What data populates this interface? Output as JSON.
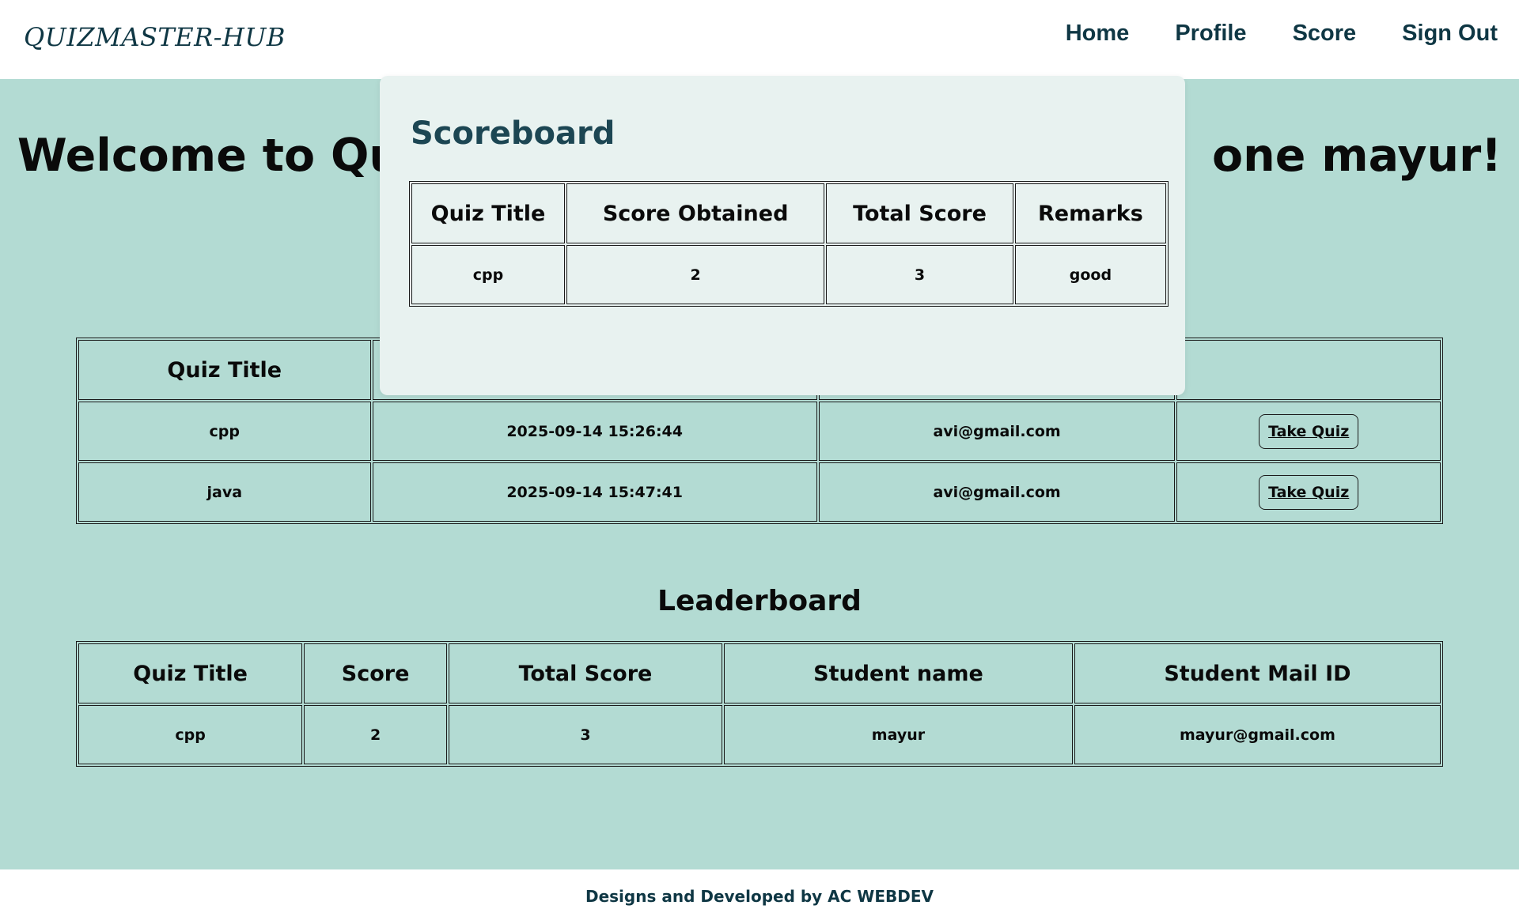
{
  "navbar": {
    "logo": "QUIZMASTER-HUB",
    "links": [
      "Home",
      "Profile",
      "Score",
      "Sign Out"
    ]
  },
  "main": {
    "welcome_prefix": "Welcome to Qu",
    "welcome_suffix": "one  mayur!"
  },
  "quizzes": {
    "headers": [
      "Quiz Title"
    ],
    "rows": [
      {
        "title": "cpp",
        "date": "2025-09-14 15:26:44",
        "email": "avi@gmail.com",
        "action": "Take Quiz"
      },
      {
        "title": "java",
        "date": "2025-09-14 15:47:41",
        "email": "avi@gmail.com",
        "action": "Take Quiz"
      }
    ]
  },
  "leaderboard": {
    "title": "Leaderboard",
    "headers": [
      "Quiz Title",
      "Score",
      "Total Score",
      "Student name",
      "Student Mail ID"
    ],
    "rows": [
      {
        "quiz": "cpp",
        "score": "2",
        "total": "3",
        "name": "mayur",
        "email": "mayur@gmail.com"
      }
    ]
  },
  "scoreboard": {
    "title": "Scoreboard",
    "headers": [
      "Quiz Title",
      "Score Obtained",
      "Total Score",
      "Remarks"
    ],
    "rows": [
      {
        "quiz": "cpp",
        "obtained": "2",
        "total": "3",
        "remarks": "good"
      }
    ]
  },
  "footer": {
    "text": "Designs and Developed by AC WEBDEV"
  },
  "colors": {
    "background": "#b3dbd3",
    "navy": "#0f3744",
    "popup": "#e8f2f0"
  }
}
